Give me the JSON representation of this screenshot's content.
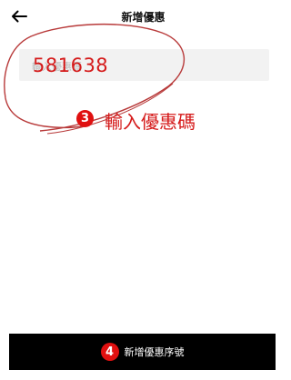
{
  "header": {
    "title": "新增優惠",
    "back_icon": "arrow-left-icon"
  },
  "coupon": {
    "placeholder": "輸入優惠碼",
    "value": "581638"
  },
  "annotations": {
    "step3_number": "3",
    "step3_text": "輸入優惠碼",
    "step4_number": "4",
    "color": "#d51a1a"
  },
  "footer": {
    "submit_label": "新增優惠序號"
  }
}
